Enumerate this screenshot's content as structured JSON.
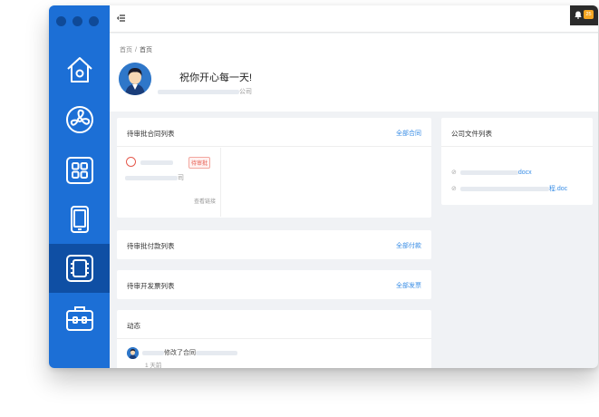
{
  "nav": {
    "items": [
      {
        "name": "home",
        "icon": "home-icon"
      },
      {
        "name": "fan",
        "icon": "fan-icon"
      },
      {
        "name": "apps",
        "icon": "grid-icon"
      },
      {
        "name": "tablet",
        "icon": "tablet-icon"
      },
      {
        "name": "chip",
        "icon": "chip-icon",
        "active": true
      },
      {
        "name": "toolbox",
        "icon": "toolbox-icon"
      }
    ],
    "accent": "#1c6fd6",
    "active_color": "#0f4fa4"
  },
  "topbar": {
    "notification_count": "25"
  },
  "header": {
    "breadcrumb": [
      "首页",
      "首页"
    ],
    "breadcrumb_sep": "/",
    "greeting": "祝你开心每一天!",
    "company_suffix": "公司"
  },
  "contracts": {
    "title": "待审批合同列表",
    "link": "全部合同",
    "item": {
      "status": "待审批",
      "name_suffix": "司",
      "more": "查看链接"
    }
  },
  "payments": {
    "title": "待审批付款列表",
    "link": "全部付款"
  },
  "invoices": {
    "title": "待审开发票列表",
    "link": "全部发票"
  },
  "activity": {
    "title": "动态",
    "text": "修改了合同",
    "time": "1 天前"
  },
  "files": {
    "title": "公司文件列表",
    "items": [
      {
        "suffix": "docx"
      },
      {
        "suffix": "程.doc"
      }
    ]
  },
  "colors": {
    "link": "#3a8ee6",
    "status_red": "#e55a4e",
    "badge": "#f5a623"
  }
}
